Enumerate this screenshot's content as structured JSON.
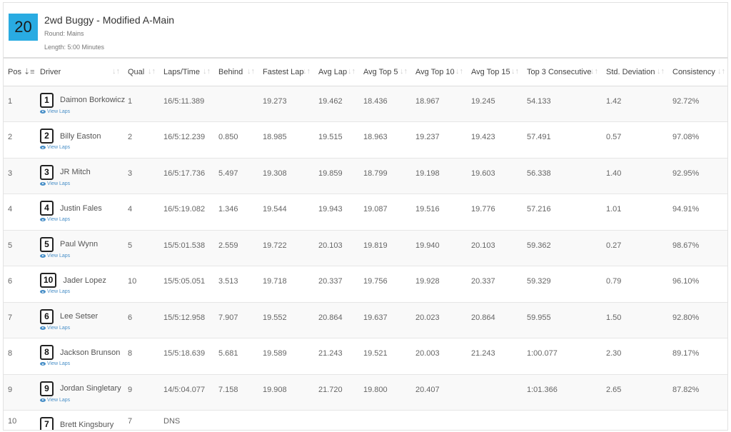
{
  "event": {
    "badge": "20",
    "title": "2wd Buggy - Modified A-Main",
    "round": "Round: Mains",
    "length": "Length: 5:00 Minutes"
  },
  "columns": [
    "Pos",
    "Driver",
    "Qual",
    "Laps/Time",
    "Behind",
    "Fastest Lap",
    "Avg Lap",
    "Avg Top 5",
    "Avg Top 10",
    "Avg Top 15",
    "Top 3 Consecutive",
    "Std. Deviation",
    "Consistency"
  ],
  "view_laps_label": "View Laps",
  "rows": [
    {
      "pos": "1",
      "num": "1",
      "driver": "Daimon Borkowicz",
      "qual": "1",
      "laps": "16/5:11.389",
      "behind": "",
      "fastest": "19.273",
      "avg": "19.462",
      "top5": "18.436",
      "top10": "18.967",
      "top15": "19.245",
      "top3c": "54.133",
      "std": "1.42",
      "cons": "92.72%"
    },
    {
      "pos": "2",
      "num": "2",
      "driver": "Billy Easton",
      "qual": "2",
      "laps": "16/5:12.239",
      "behind": "0.850",
      "fastest": "18.985",
      "avg": "19.515",
      "top5": "18.963",
      "top10": "19.237",
      "top15": "19.423",
      "top3c": "57.491",
      "std": "0.57",
      "cons": "97.08%"
    },
    {
      "pos": "3",
      "num": "3",
      "driver": "JR Mitch",
      "qual": "3",
      "laps": "16/5:17.736",
      "behind": "5.497",
      "fastest": "19.308",
      "avg": "19.859",
      "top5": "18.799",
      "top10": "19.198",
      "top15": "19.603",
      "top3c": "56.338",
      "std": "1.40",
      "cons": "92.95%"
    },
    {
      "pos": "4",
      "num": "4",
      "driver": "Justin Fales",
      "qual": "4",
      "laps": "16/5:19.082",
      "behind": "1.346",
      "fastest": "19.544",
      "avg": "19.943",
      "top5": "19.087",
      "top10": "19.516",
      "top15": "19.776",
      "top3c": "57.216",
      "std": "1.01",
      "cons": "94.91%"
    },
    {
      "pos": "5",
      "num": "5",
      "driver": "Paul Wynn",
      "qual": "5",
      "laps": "15/5:01.538",
      "behind": "2.559",
      "fastest": "19.722",
      "avg": "20.103",
      "top5": "19.819",
      "top10": "19.940",
      "top15": "20.103",
      "top3c": "59.362",
      "std": "0.27",
      "cons": "98.67%"
    },
    {
      "pos": "6",
      "num": "10",
      "driver": "Jader Lopez",
      "qual": "10",
      "laps": "15/5:05.051",
      "behind": "3.513",
      "fastest": "19.718",
      "avg": "20.337",
      "top5": "19.756",
      "top10": "19.928",
      "top15": "20.337",
      "top3c": "59.329",
      "std": "0.79",
      "cons": "96.10%"
    },
    {
      "pos": "7",
      "num": "6",
      "driver": "Lee Setser",
      "qual": "6",
      "laps": "15/5:12.958",
      "behind": "7.907",
      "fastest": "19.552",
      "avg": "20.864",
      "top5": "19.637",
      "top10": "20.023",
      "top15": "20.864",
      "top3c": "59.955",
      "std": "1.50",
      "cons": "92.80%"
    },
    {
      "pos": "8",
      "num": "8",
      "driver": "Jackson Brunson",
      "qual": "8",
      "laps": "15/5:18.639",
      "behind": "5.681",
      "fastest": "19.589",
      "avg": "21.243",
      "top5": "19.521",
      "top10": "20.003",
      "top15": "21.243",
      "top3c": "1:00.077",
      "std": "2.30",
      "cons": "89.17%"
    },
    {
      "pos": "9",
      "num": "9",
      "driver": "Jordan Singletary",
      "qual": "9",
      "laps": "14/5:04.077",
      "behind": "7.158",
      "fastest": "19.908",
      "avg": "21.720",
      "top5": "19.800",
      "top10": "20.407",
      "top15": "",
      "top3c": "1:01.366",
      "std": "2.65",
      "cons": "87.82%"
    },
    {
      "pos": "10",
      "num": "7",
      "driver": "Brett Kingsbury",
      "qual": "7",
      "laps": "DNS",
      "behind": "",
      "fastest": "",
      "avg": "",
      "top5": "",
      "top10": "",
      "top15": "",
      "top3c": "",
      "std": "",
      "cons": ""
    }
  ]
}
